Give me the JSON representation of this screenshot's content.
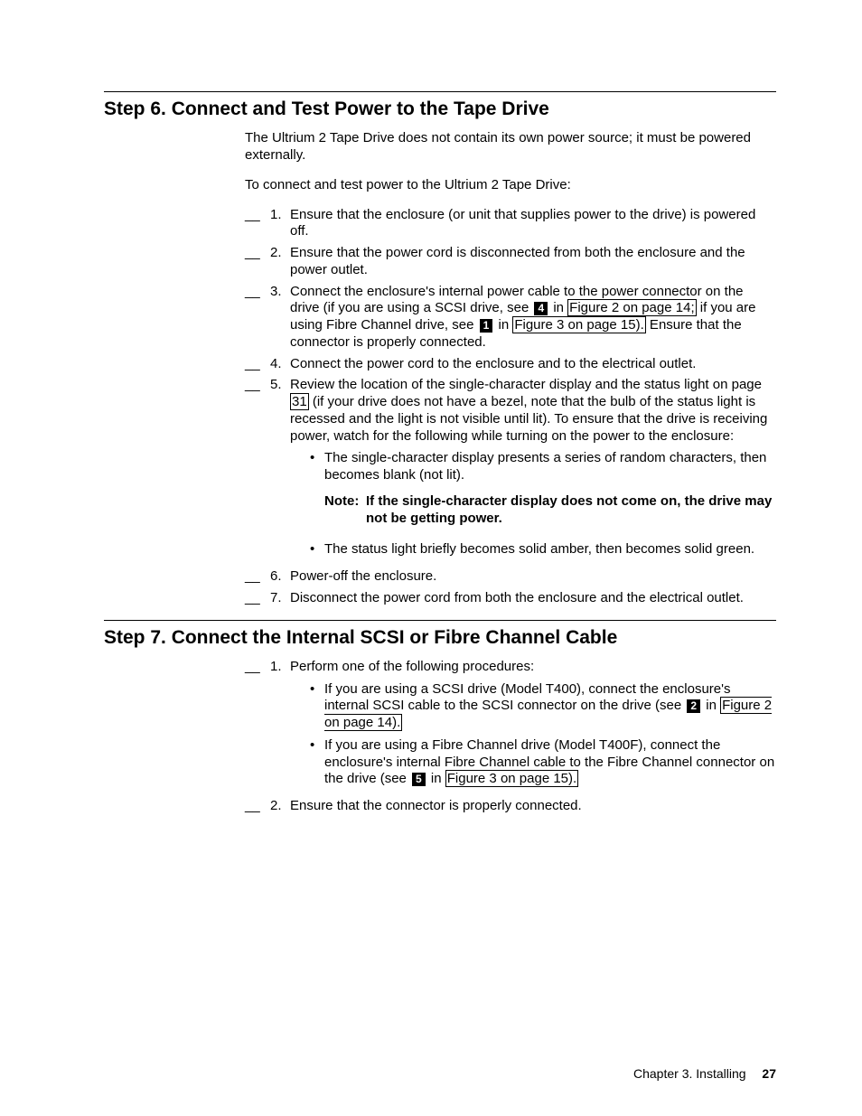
{
  "step6": {
    "title": "Step 6. Connect and Test Power to the Tape Drive",
    "intro": "The Ultrium 2 Tape Drive does not contain its own power source; it must be powered externally.",
    "lead": "To connect and test power to the Ultrium 2 Tape Drive:",
    "items": {
      "n1": "1.",
      "t1": "Ensure that the enclosure (or unit that supplies power to the drive) is powered off.",
      "n2": "2.",
      "t2": "Ensure that the power cord is disconnected from both the enclosure and the power outlet.",
      "n3": "3.",
      "t3a": "Connect the enclosure's internal power cable to the power connector on the drive (if you are using a SCSI drive, see ",
      "c4": "4",
      "t3b": " in ",
      "x3a": "Figure 2 on page 14;",
      "t3c": " if you are using Fibre Channel drive, see ",
      "c1": "1",
      "t3d": " in ",
      "x3b": "Figure 3 on page 15).",
      "t3e": " Ensure that the connector is properly connected.",
      "n4": "4.",
      "t4": "Connect the power cord to the enclosure and to the electrical outlet.",
      "n5": "5.",
      "t5a": "Review the location of the single-character display and the status light on page ",
      "x5": "31",
      "t5b": " (if your drive does not have a bezel, note that the bulb of the status light is recessed and the light is not visible until lit). To ensure that the drive is receiving power, watch for the following while turning on the power to the enclosure:",
      "b1": "The single-character display presents a series of random characters, then becomes blank (not lit).",
      "noteLabel": "Note:",
      "noteText": "If the single-character display does not come on, the drive may not be getting power.",
      "b2": "The status light briefly becomes solid amber, then becomes solid green.",
      "n6": "6.",
      "t6": "Power-off the enclosure.",
      "n7": "7.",
      "t7": "Disconnect the power cord from both the enclosure and the electrical outlet."
    }
  },
  "step7": {
    "title": "Step 7. Connect the Internal SCSI or Fibre Channel Cable",
    "items": {
      "n1": "1.",
      "t1": "Perform one of the following procedures:",
      "b1a": "If you are using a SCSI drive (Model T400), connect the enclosure's internal SCSI cable to the SCSI connector on the drive (see ",
      "c2": "2",
      "b1b": " in ",
      "x1": "Figure 2 on page 14).",
      "b2a": "If you are using a Fibre Channel drive (Model T400F), connect the enclosure's internal Fibre Channel cable to the Fibre Channel connector on the drive (see ",
      "c5": "5",
      "b2b": " in ",
      "x2": "Figure 3 on page 15).",
      "n2": "2.",
      "t2": "Ensure that the connector is properly connected."
    }
  },
  "footer": {
    "chapter": "Chapter 3. Installing",
    "page": "27"
  },
  "blank": "__"
}
